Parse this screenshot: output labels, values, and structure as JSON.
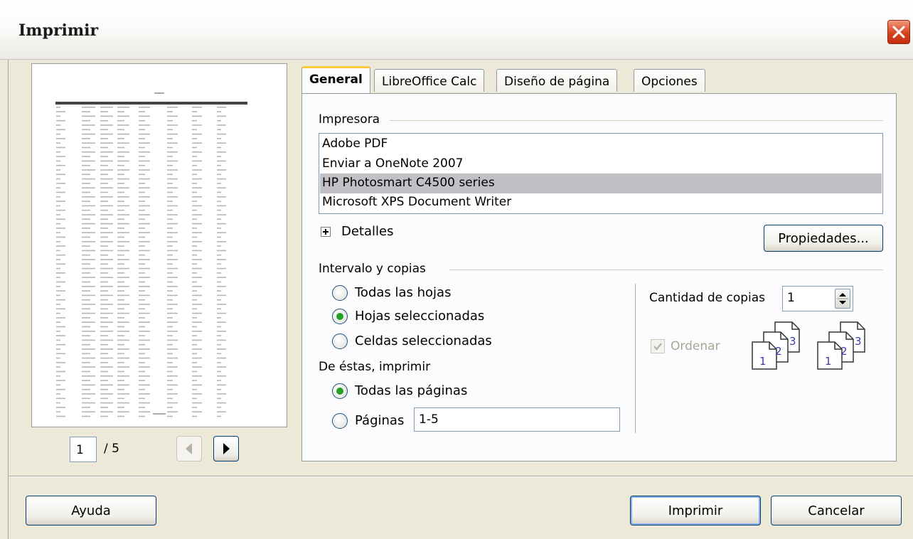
{
  "window": {
    "title": "Imprimir"
  },
  "preview": {
    "page_current": "1",
    "page_total": "/ 5"
  },
  "tabs": [
    {
      "label": "General",
      "active": true
    },
    {
      "label": "LibreOffice Calc",
      "active": false
    },
    {
      "label": "Diseño de página",
      "active": false
    },
    {
      "label": "Opciones",
      "active": false
    }
  ],
  "printer": {
    "group_label": "Impresora",
    "items": [
      {
        "label": "Adobe PDF"
      },
      {
        "label": "Enviar a OneNote 2007"
      },
      {
        "label": "HP Photosmart C4500 series",
        "selected": true
      },
      {
        "label": "Microsoft XPS Document Writer"
      }
    ],
    "details_label": "Detalles",
    "properties_label": "Propiedades..."
  },
  "range": {
    "group_label": "Intervalo y copias",
    "all_sheets": "Todas las hojas",
    "selected_sheets": "Hojas seleccionadas",
    "selected_cells": "Celdas seleccionadas",
    "of_these_label": "De éstas, imprimir",
    "all_pages": "Todas las páginas",
    "pages_label": "Páginas",
    "pages_value": "1-5",
    "selected_option": "Hojas seleccionadas",
    "pages_option": "Todas las páginas"
  },
  "copies": {
    "label": "Cantidad de copias",
    "value": "1",
    "collate_label": "Ordenar",
    "collate_checked": true,
    "collate_enabled": false
  },
  "buttons": {
    "help": "Ayuda",
    "print": "Imprimir",
    "cancel": "Cancelar"
  },
  "colors": {
    "dialog_bg": "#ece9d8",
    "selection_bg": "#c1c1c5",
    "tab_highlight": "#ffc83c",
    "radio_dot": "#21a121",
    "close_red": "#d8431d"
  }
}
